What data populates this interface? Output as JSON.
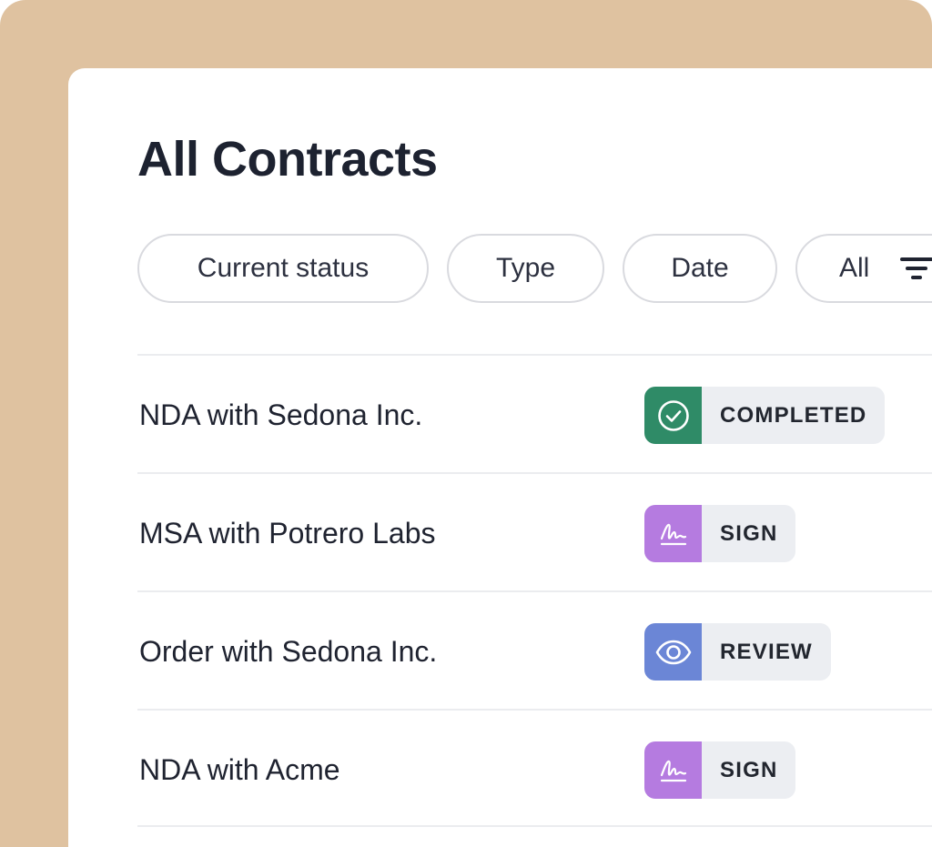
{
  "page": {
    "title": "All Contracts"
  },
  "filters": [
    {
      "label": "Current status"
    },
    {
      "label": "Type"
    },
    {
      "label": "Date"
    },
    {
      "label": "All",
      "icon": "filter-icon"
    }
  ],
  "contracts": [
    {
      "name": "NDA with Sedona Inc.",
      "status": "COMPLETED",
      "icon": "check-circle-icon",
      "color": "#2f8b67"
    },
    {
      "name": "MSA with Potrero Labs",
      "status": "SIGN",
      "icon": "signature-icon",
      "color": "#b57be0"
    },
    {
      "name": "Order with Sedona Inc.",
      "status": "REVIEW",
      "icon": "eye-icon",
      "color": "#6b86d6"
    },
    {
      "name": "NDA with Acme",
      "status": "SIGN",
      "icon": "signature-icon",
      "color": "#b57be0"
    }
  ],
  "colors": {
    "background": "#dfc2a0",
    "card": "#ffffff",
    "badge_bg": "#eceef2",
    "divider": "#ebecef"
  }
}
